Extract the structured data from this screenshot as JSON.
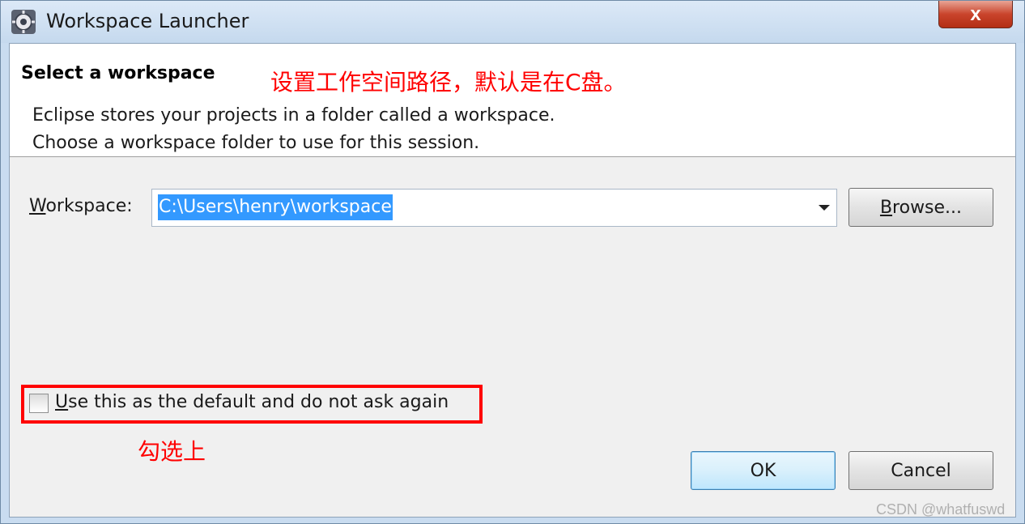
{
  "window": {
    "title": "Workspace Launcher",
    "close_symbol": "x"
  },
  "header": {
    "title": "Select a workspace",
    "annotation": "设置工作空间路径，默认是在C盘。",
    "description_lines": [
      "Eclipse stores your projects in a folder called a workspace.",
      "Choose a workspace folder to use for this session."
    ]
  },
  "workspace": {
    "label_mnemonic": "W",
    "label_rest": "orkspace:",
    "value": "C:\\Users\\henry\\workspace"
  },
  "buttons": {
    "browse_mnemonic": "B",
    "browse_rest": "rowse...",
    "ok": "OK",
    "cancel": "Cancel"
  },
  "default_option": {
    "checked": false,
    "label_mnemonic": "U",
    "label_rest": "se this as the default and do not ask again",
    "annotation": "勾选上"
  },
  "watermark": "CSDN @whatfuswd",
  "colors": {
    "annotation": "#ff0000",
    "selection": "#3399ff"
  },
  "icons": {
    "app": "eclipse-gear-icon",
    "close": "close-icon",
    "dropdown": "chevron-down-icon"
  }
}
